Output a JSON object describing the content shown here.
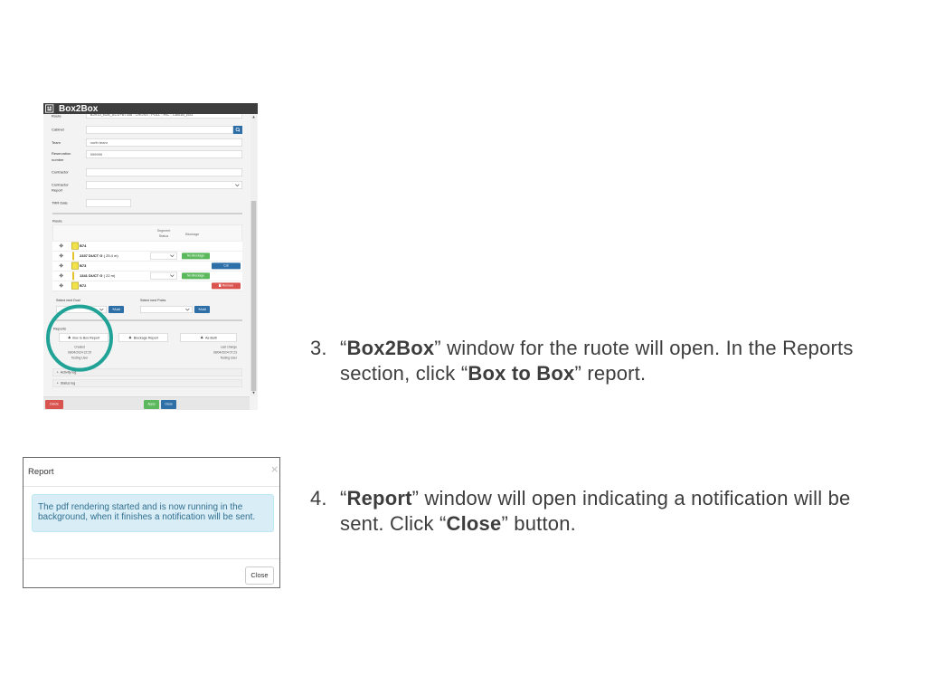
{
  "colors": {
    "primary": "#2f6fa8",
    "success": "#5cb85c",
    "danger": "#d9534f",
    "marker": "#f2e24a",
    "annotation": "#20a396",
    "alert_bg": "#d9edf7",
    "alert_text": "#31708f",
    "title_bar": "#3d3d3d"
  },
  "slide": {
    "steps": [
      {
        "number": "3.",
        "lines": [
          [
            "“",
            "Box2Box",
            "” window for the ruote will open. In the Reports"
          ],
          [
            "section, click “",
            "Box to Box",
            "” report."
          ]
        ]
      },
      {
        "number": "4.",
        "lines": [
          [
            "“",
            "Report",
            "” window will open indicating a notification will be"
          ],
          [
            "sent. Click “",
            "Close",
            "” button."
          ]
        ]
      }
    ]
  },
  "box2box_window": {
    "title": "Box2Box",
    "icons": {
      "app": "grid-icon",
      "search": "search-icon",
      "move": "move-icon",
      "report": "cloud-download-icon",
      "remove": "trash-icon",
      "add": "plus-icon",
      "expand": "plus-icon",
      "dropdown": "chevron-down-icon"
    },
    "fields": {
      "route": {
        "label": "Route",
        "value": "B2R10_B2B_ACU+B7348 ; CROSS ; POLL ; HIC ; CAB1B_B03"
      },
      "cabinet": {
        "label": "Cabinet",
        "value": ""
      },
      "team": {
        "label": "Team",
        "value": "north team"
      },
      "reservation_number": {
        "label_line1": "Reservation",
        "label_line2": "number",
        "value": "999999"
      },
      "contractor": {
        "label": "Contractor",
        "value": ""
      },
      "contractor_report": {
        "label_line1": "Contractor",
        "label_line2": "Report",
        "value": ""
      },
      "trr_date": {
        "label": "TRR Date",
        "value": ""
      }
    },
    "route_section": {
      "label": "Route",
      "headers": {
        "segment_status_line1": "Segment",
        "segment_status_line2": "Status",
        "blockage": "Blockage"
      },
      "rows": [
        {
          "name": "B74",
          "icon": "box-marker-icon"
        },
        {
          "name": "2337 DUCT G",
          "length": "( 25.4 m)",
          "segment_status": "",
          "blockage": "No Blockage",
          "icon": "duct-marker-icon"
        },
        {
          "name": "B73",
          "action": "Cut",
          "icon": "box-marker-icon"
        },
        {
          "name": "1341 DUCT G",
          "length": "( 22 m)",
          "segment_status": "",
          "blockage": "No Blockage",
          "icon": "duct-marker-icon"
        },
        {
          "name": "B72",
          "action": "Remove",
          "icon": "box-marker-icon"
        }
      ]
    },
    "next_duct": {
      "label": "Select next Duct",
      "value": "",
      "add_label": "Add"
    },
    "next_poles": {
      "label": "Select next Poles",
      "value": "",
      "add_label": "Add"
    },
    "reports": {
      "label": "Reports",
      "buttons": [
        "Box to Box Report",
        "Blockage Report",
        "As-Built"
      ],
      "created": {
        "label": "Created",
        "date": "08/04/2024 22:25",
        "user": "Testing User"
      },
      "last_change": {
        "label": "Last change",
        "date": "08/04/2024 07:23",
        "user": "Testing User"
      }
    },
    "logs": [
      "Activity log",
      "Status log"
    ],
    "footer": {
      "delete": "Delete",
      "apply": "Apply",
      "close": "Close"
    }
  },
  "report_dialog": {
    "title": "Report",
    "close_glyph": "×",
    "message": "The pdf rendering started and is now running in the background, when it finishes a notification will be sent.",
    "close_button": "Close"
  }
}
